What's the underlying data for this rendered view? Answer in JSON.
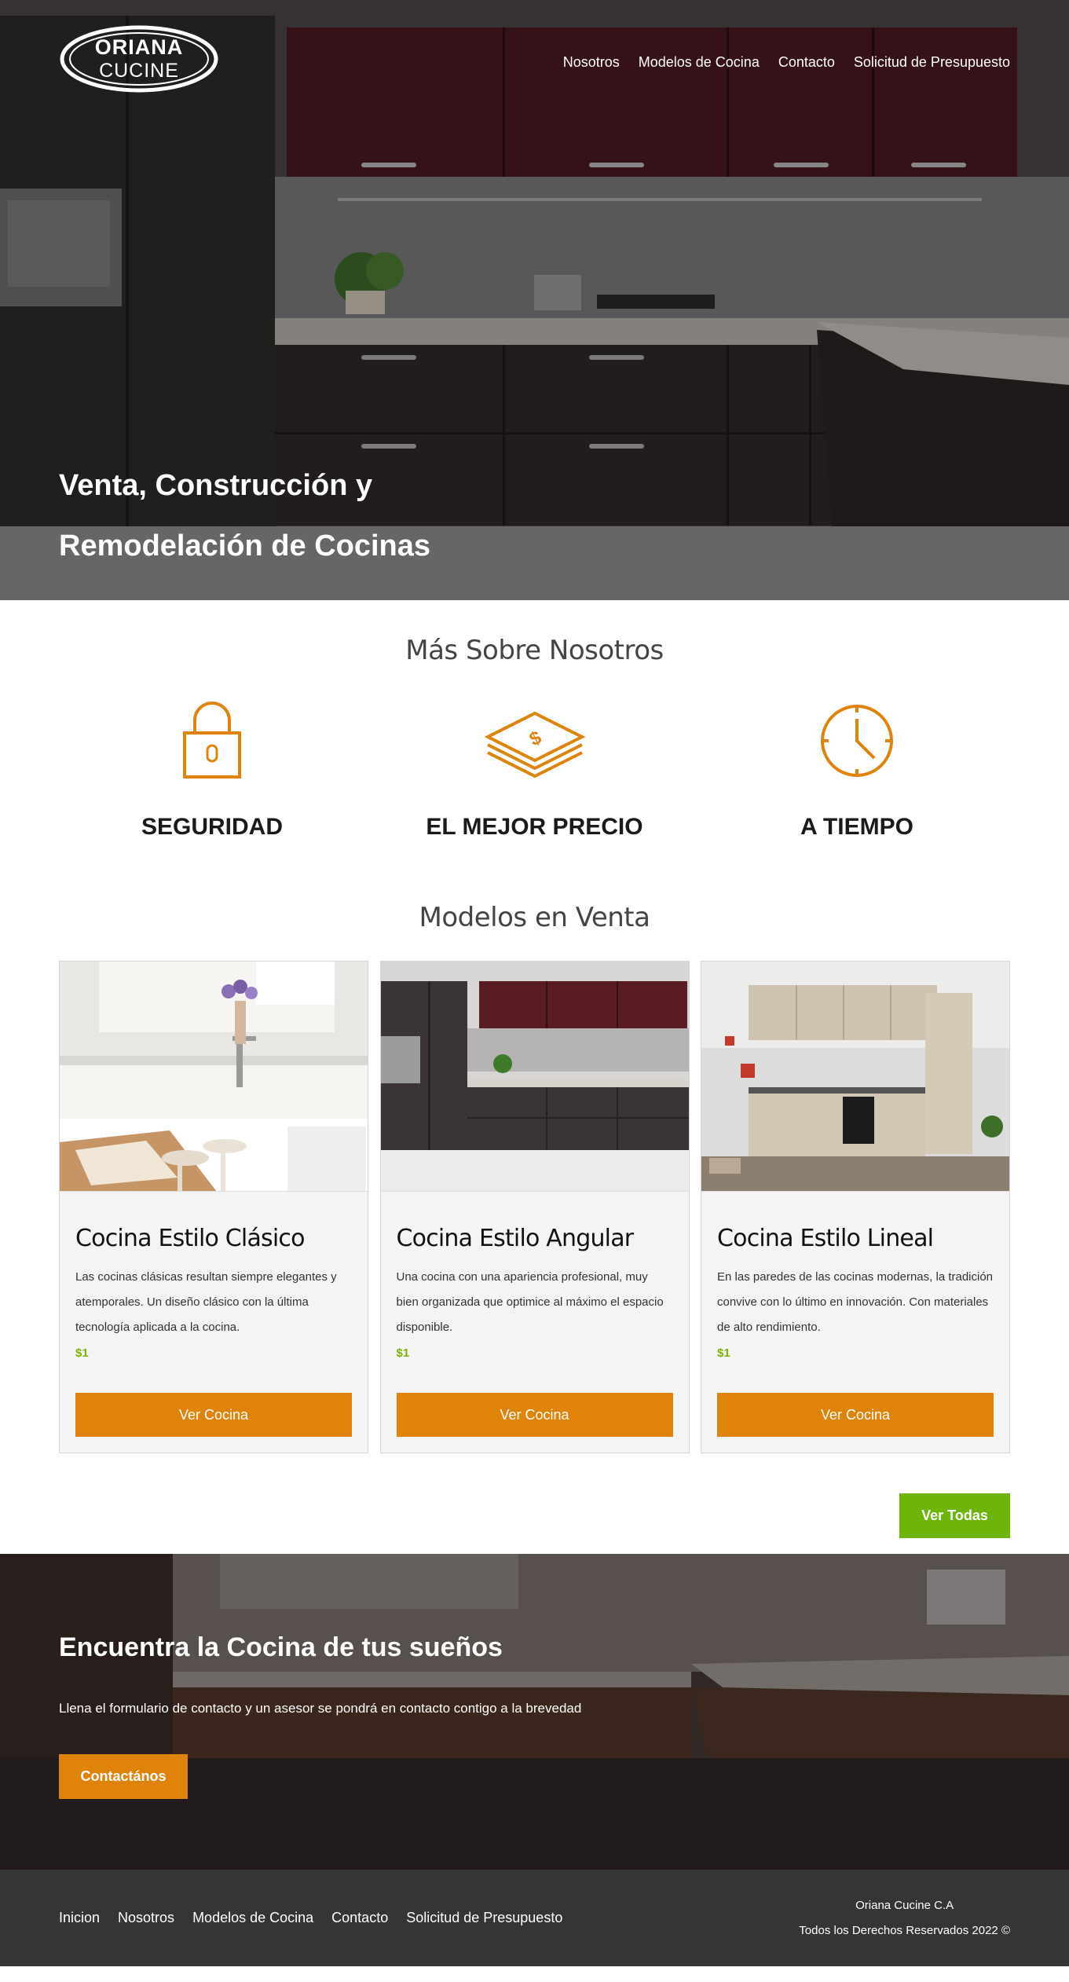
{
  "brand": {
    "line1": "ORIANA",
    "line2": "CUCINE"
  },
  "nav": [
    "Nosotros",
    "Modelos de Cocina",
    "Contacto",
    "Solicitud de Presupuesto"
  ],
  "hero": {
    "title_line1": "Venta, Construcción y",
    "title_line2": "Remodelación de Cocinas"
  },
  "about": {
    "title": "Más Sobre Nosotros",
    "features": [
      {
        "icon": "padlock-icon",
        "label": "SEGURIDAD"
      },
      {
        "icon": "money-stack-icon",
        "label": "EL MEJOR PRECIO"
      },
      {
        "icon": "clock-icon",
        "label": "A TIEMPO"
      }
    ]
  },
  "models": {
    "title": "Modelos en Venta",
    "cards": [
      {
        "title": "Cocina Estilo Clásico",
        "description": "Las cocinas clásicas resultan siempre elegantes y atemporales. Un diseño clásico con la última tecnología aplicada a la cocina.",
        "price": "$1",
        "button": "Ver Cocina"
      },
      {
        "title": "Cocina Estilo Angular",
        "description": "Una cocina con una apariencia profesional, muy bien organizada que optimice al máximo el espacio disponible.",
        "price": "$1",
        "button": "Ver Cocina"
      },
      {
        "title": "Cocina Estilo Lineal",
        "description": "En las paredes de las cocinas modernas, la tradición convive con lo último en innovación. Con materiales de alto rendimiento.",
        "price": "$1",
        "button": "Ver Cocina"
      }
    ],
    "view_all": "Ver Todas"
  },
  "cta": {
    "title": "Encuentra la Cocina de tus sueños",
    "text": "Llena el formulario de contacto y un asesor se pondrá en contacto contigo a la brevedad",
    "button": "Contactános"
  },
  "footer": {
    "nav": [
      "Inicion",
      "Nosotros",
      "Modelos de Cocina",
      "Contacto",
      "Solicitud de Presupuesto"
    ],
    "company": "Oriana Cucine C.A",
    "rights": "Todos los Derechos Reservados 2022 ©"
  },
  "colors": {
    "accent": "#df830b",
    "green": "#6fb40b",
    "price": "#7cb400",
    "footer": "#353535"
  }
}
